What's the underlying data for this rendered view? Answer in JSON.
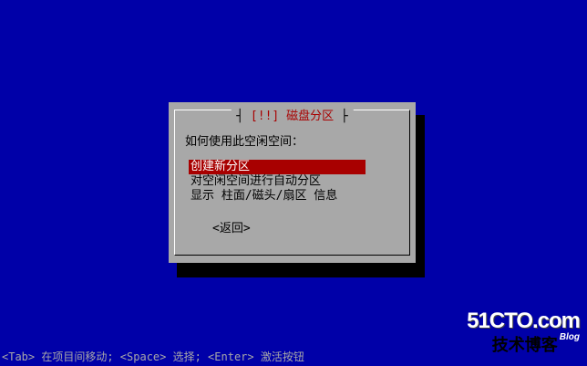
{
  "dialog": {
    "title_left": "[!!]",
    "title_text": "磁盘分区",
    "prompt": "如何使用此空闲空间：",
    "options": [
      "创建新分区",
      "对空闲空间进行自动分区",
      "显示 柱面/磁头/扇区 信息"
    ],
    "selected_index": 0,
    "back_label": "<返回>"
  },
  "help_line": "<Tab> 在项目间移动; <Space> 选择; <Enter> 激活按钮",
  "watermark": {
    "line1": "51CTO.com",
    "line2": "技术博客",
    "badge": "Blog"
  },
  "colors": {
    "background": "#0000a8",
    "dialog": "#a8a8a8",
    "accent": "#a80000"
  }
}
